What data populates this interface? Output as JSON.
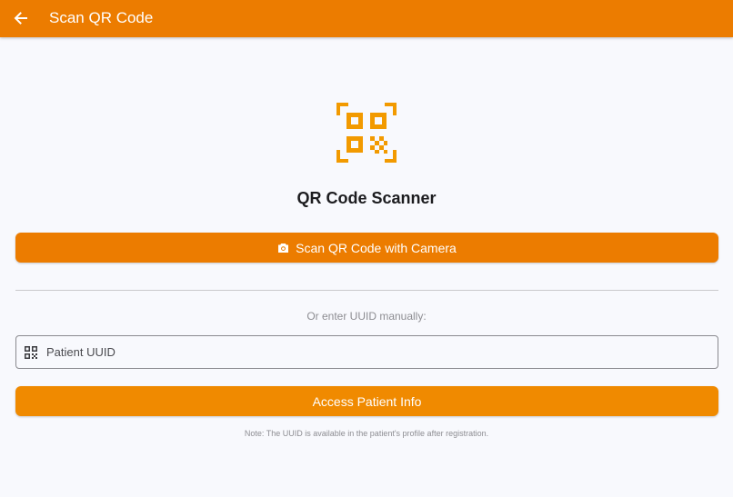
{
  "appbar": {
    "title": "Scan QR Code",
    "back_icon": "arrow-back-icon",
    "color": "#ec7c00"
  },
  "hero": {
    "icon": "qr-code-scanner-icon",
    "icon_color": "#f29a00",
    "title": "QR Code Scanner"
  },
  "scan_button": {
    "icon": "camera-icon",
    "label": "Scan QR Code with Camera",
    "color": "#ec7c00"
  },
  "manual": {
    "or_text": "Or enter UUID manually:",
    "field_icon": "qr-code-icon",
    "placeholder": "Patient UUID",
    "value": ""
  },
  "access_button": {
    "label": "Access Patient Info",
    "color": "#f08a00"
  },
  "note": "Note: The UUID is available in the patient's profile after registration."
}
